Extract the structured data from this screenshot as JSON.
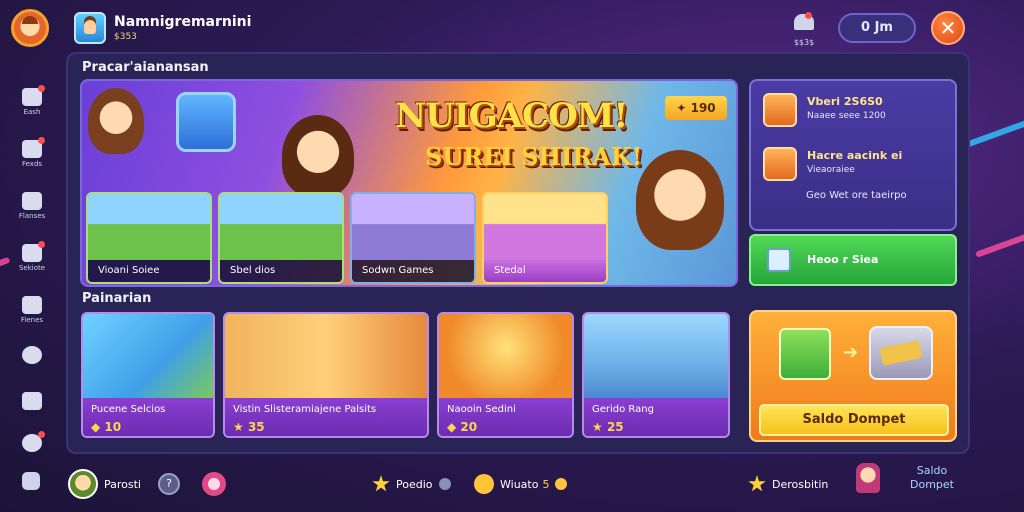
{
  "header": {
    "profile_name": "Namnigremarnini",
    "profile_sub": "$353",
    "notif_label": "$$3$",
    "currency": "0 Jm",
    "close_symbol": "✕"
  },
  "sidebar": {
    "items": [
      {
        "label": "Eash",
        "icon": "gift-icon"
      },
      {
        "label": "Fexds",
        "icon": "chat-icon"
      },
      {
        "label": "Flanses",
        "icon": "shield-icon"
      },
      {
        "label": "Sekiote",
        "icon": "edit-icon"
      },
      {
        "label": "Fienes",
        "icon": "tag-icon"
      },
      {
        "label": "",
        "icon": "gear-icon"
      },
      {
        "label": "",
        "icon": "chat-bubble-icon"
      },
      {
        "label": "",
        "icon": "character-icon"
      },
      {
        "label": "",
        "icon": "camera-icon"
      }
    ]
  },
  "featured": {
    "section_title": "Pracar'aianansan",
    "headline": "NUIGACOM!",
    "subline": "SUREI SHIRAK!",
    "price_tag": "✦ 190",
    "games": [
      {
        "label": "Vioani Soiee"
      },
      {
        "label": "Sbel dios"
      },
      {
        "label": "Sodwn Games"
      },
      {
        "label": "Stedal"
      }
    ]
  },
  "info_panel": {
    "rows": [
      {
        "title": "Vberi 2S6S0",
        "sub": "Naaee seee      1200"
      },
      {
        "title": "Hacre aacink ei",
        "sub": "Vieaoraiee"
      }
    ],
    "line3": "Geo Wet ore taeirpo",
    "green_button": "Heoo r Siea"
  },
  "products": {
    "section_title": "Painarian",
    "items": [
      {
        "name": "Pucene Selcios",
        "price": "10"
      },
      {
        "name": "Vistin Slisteramiajene Palsits",
        "price": "35"
      },
      {
        "name": "Naooin Sedini",
        "price": "20"
      },
      {
        "name": "Gerido Rang",
        "price": "25"
      }
    ]
  },
  "wallet": {
    "button_label": "Saldo Dompet"
  },
  "bottom_bar": {
    "user_name": "Parosti",
    "circle_label": "?",
    "item1": "Poedio",
    "item2": "Wiuato",
    "item2_count": "5",
    "item3": "Derosbitin",
    "wallet_line1": "Saldo",
    "wallet_line2": "Dompet"
  }
}
